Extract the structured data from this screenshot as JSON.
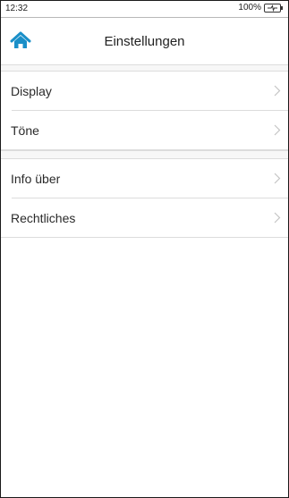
{
  "status_bar": {
    "time": "12:32",
    "battery": "100%",
    "battery_icon": "battery-charging-icon"
  },
  "nav": {
    "home_icon": "home-icon",
    "title": "Einstellungen"
  },
  "settings": {
    "groups": [
      {
        "items": [
          {
            "label": "Display"
          },
          {
            "label": "Töne"
          }
        ]
      },
      {
        "items": [
          {
            "label": "Info über"
          },
          {
            "label": "Rechtliches"
          }
        ]
      }
    ]
  },
  "colors": {
    "accent": "#1a8fc8",
    "text": "#222222",
    "divider": "#dcdcdc",
    "chevron": "#c4c4c4"
  }
}
